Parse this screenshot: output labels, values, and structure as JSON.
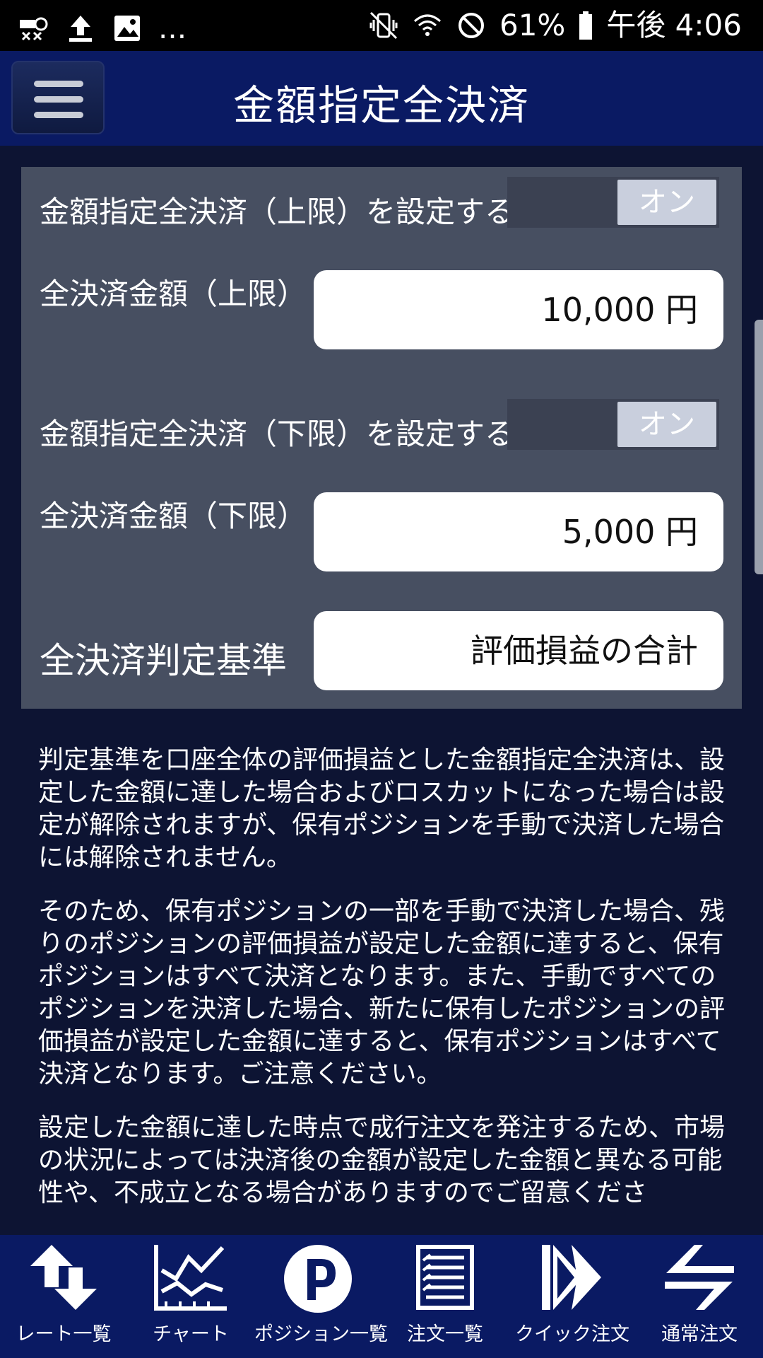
{
  "statusbar": {
    "battery": "61%",
    "time": "午後 4:06",
    "left_icons": [
      "sim-settings-icon",
      "upload-icon",
      "image-icon",
      "more-dots-icon"
    ],
    "right_icons": [
      "vibrate-icon",
      "wifi-icon",
      "do-not-disturb-icon",
      "battery-icon"
    ],
    "more": "..."
  },
  "header": {
    "title": "金額指定全決済"
  },
  "settings": {
    "upper_toggle_label": "金額指定全決済（上限）を設定する",
    "upper_toggle_state": "オン",
    "upper_amount_label": "全決済金額（上限）",
    "upper_amount_value": "10,000 円",
    "lower_toggle_label": "金額指定全決済（下限）を設定する",
    "lower_toggle_state": "オン",
    "lower_amount_label": "全決済金額（下限）",
    "lower_amount_value": "5,000 円",
    "criteria_label": "全決済判定基準",
    "criteria_value": "評価損益の合計"
  },
  "description": {
    "p1": "判定基準を口座全体の評価損益とした金額指定全決済は、設定した金額に達した場合およびロスカットになった場合は設定が解除されますが、保有ポジションを手動で決済した場合には解除されません。",
    "p2": "そのため、保有ポジションの一部を手動で決済した場合、残りのポジションの評価損益が設定した金額に達すると、保有ポジションはすべて決済となります。また、手動ですべてのポジションを決済した場合、新たに保有したポジションの評価損益が設定した金額に達すると、保有ポジションはすべて決済となります。ご注意ください。",
    "p3": "設定した金額に達した時点で成行注文を発注するため、市場の状況によっては決済後の金額が設定した金額と異なる可能性や、不成立となる場合がありますのでご留意くださ"
  },
  "bottom_nav": {
    "items": [
      {
        "label": "レート一覧",
        "icon": "rate-arrows-icon"
      },
      {
        "label": "チャート",
        "icon": "chart-icon"
      },
      {
        "label": "ポジション一覧",
        "icon": "position-p-icon"
      },
      {
        "label": "注文一覧",
        "icon": "order-list-icon"
      },
      {
        "label": "クイック注文",
        "icon": "quick-order-icon"
      },
      {
        "label": "通常注文",
        "icon": "normal-order-icon"
      }
    ]
  },
  "colors": {
    "background": "#0d1433",
    "header": "#0a1a63",
    "panel": "#474f61",
    "toggle_knob": "#c9cfdd"
  }
}
